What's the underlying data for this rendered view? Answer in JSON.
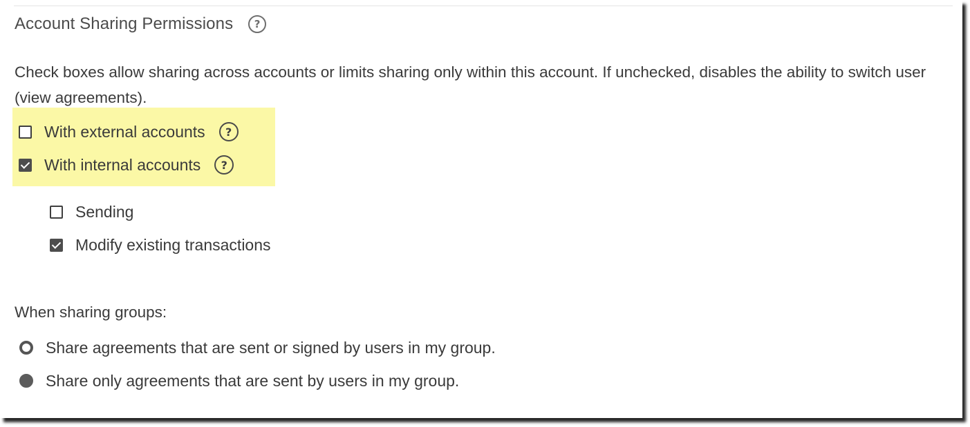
{
  "section": {
    "title": "Account Sharing Permissions",
    "title_help_icon": "question-circle-icon",
    "description": "Check boxes allow sharing across accounts or limits sharing only within this account. If unchecked, disables the ability to switch user (view agreements)."
  },
  "highlight_color": "#fbf8a6",
  "checkboxes": {
    "external": {
      "label": "With external accounts",
      "checked": false,
      "help_icon": "question-circle-icon"
    },
    "internal": {
      "label": "With internal accounts",
      "checked": true,
      "help_icon": "question-circle-icon"
    },
    "sending": {
      "label": "Sending",
      "checked": false
    },
    "modify": {
      "label": "Modify existing transactions",
      "checked": true
    }
  },
  "groups": {
    "label": "When sharing groups:",
    "options": [
      {
        "label": "Share agreements that are sent or signed by users in my group.",
        "selected": false
      },
      {
        "label": "Share only agreements that are sent by users in my group.",
        "selected": true
      }
    ]
  },
  "help_glyph": "?"
}
